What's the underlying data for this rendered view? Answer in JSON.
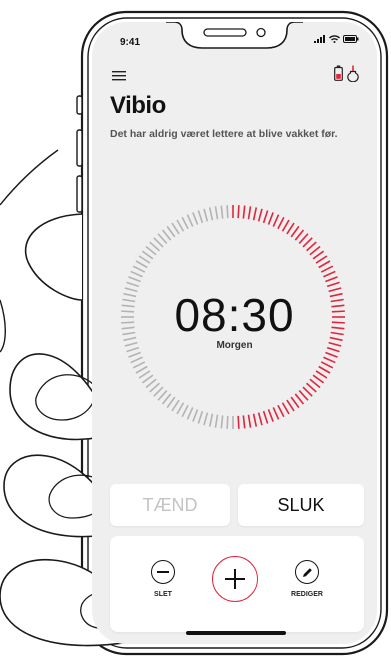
{
  "status_bar": {
    "time": "9:41",
    "signal_icon": "signal-bars-icon",
    "wifi_icon": "wifi-icon",
    "battery_icon": "battery-icon"
  },
  "header": {
    "menu_icon": "hamburger-menu-icon",
    "battery_status_icon": "battery-low-icon",
    "alarm_device_icon": "vibrating-alarm-icon",
    "title": "Vibio",
    "subtitle": "Det har aldrig været lettere at blive vakket før."
  },
  "alarm": {
    "time": "08:30",
    "label": "Morgen",
    "progress_fraction": 0.5
  },
  "buttons": {
    "on_label": "TÆND",
    "off_label": "SLUK"
  },
  "controls": {
    "delete_label": "SLET",
    "add_icon": "plus-icon",
    "delete_icon": "minus-icon",
    "edit_icon": "pencil-icon",
    "edit_label": "REDIGER"
  },
  "colors": {
    "accent": "#e0253c",
    "inactive_tick": "#b3b3b3",
    "screen_bg": "#efefef"
  }
}
